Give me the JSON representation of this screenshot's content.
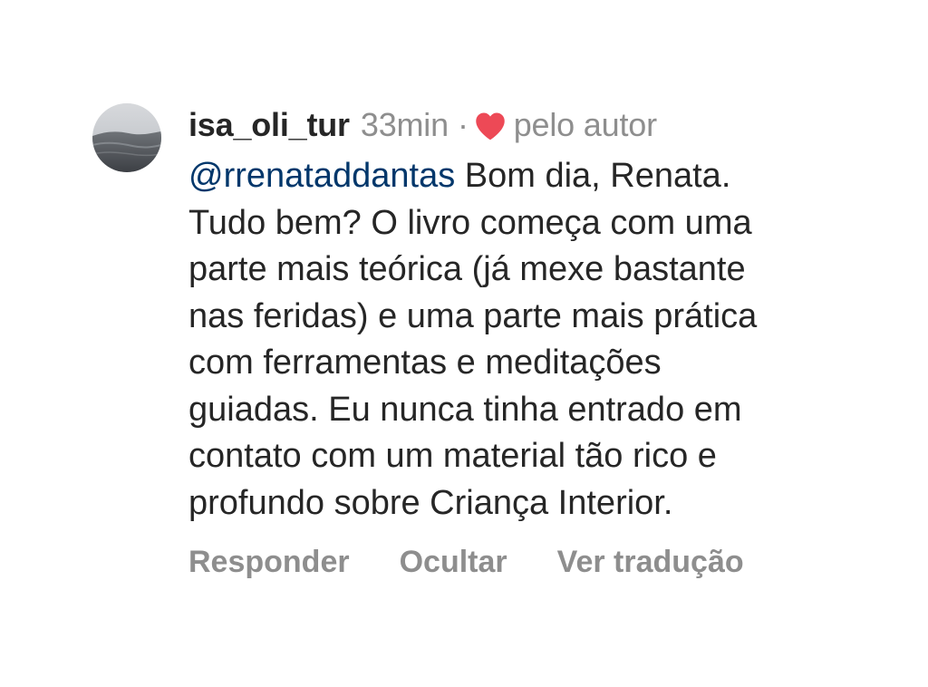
{
  "comment": {
    "username": "isa_oli_tur",
    "time": "33min",
    "separator": "·",
    "liked_by_author": "pelo autor",
    "mention": "@rrenataddantas",
    "text_lines": [
      " Bom dia, Renata.",
      "Tudo bem? O livro começa com uma",
      "parte mais teórica (já mexe bastante",
      "nas feridas) e uma parte mais prática",
      "com ferramentas e meditações",
      "guiadas. Eu nunca tinha entrado em",
      "contato com um material tão rico e",
      "profundo sobre Criança Interior."
    ],
    "actions": {
      "reply": "Responder",
      "hide": "Ocultar",
      "translate": "Ver tradução"
    }
  },
  "icons": {
    "heart": "heart-filled-icon"
  },
  "colors": {
    "text": "#262626",
    "secondary": "#8e8e8e",
    "mention": "#00376b",
    "heart": "#ed4956"
  }
}
